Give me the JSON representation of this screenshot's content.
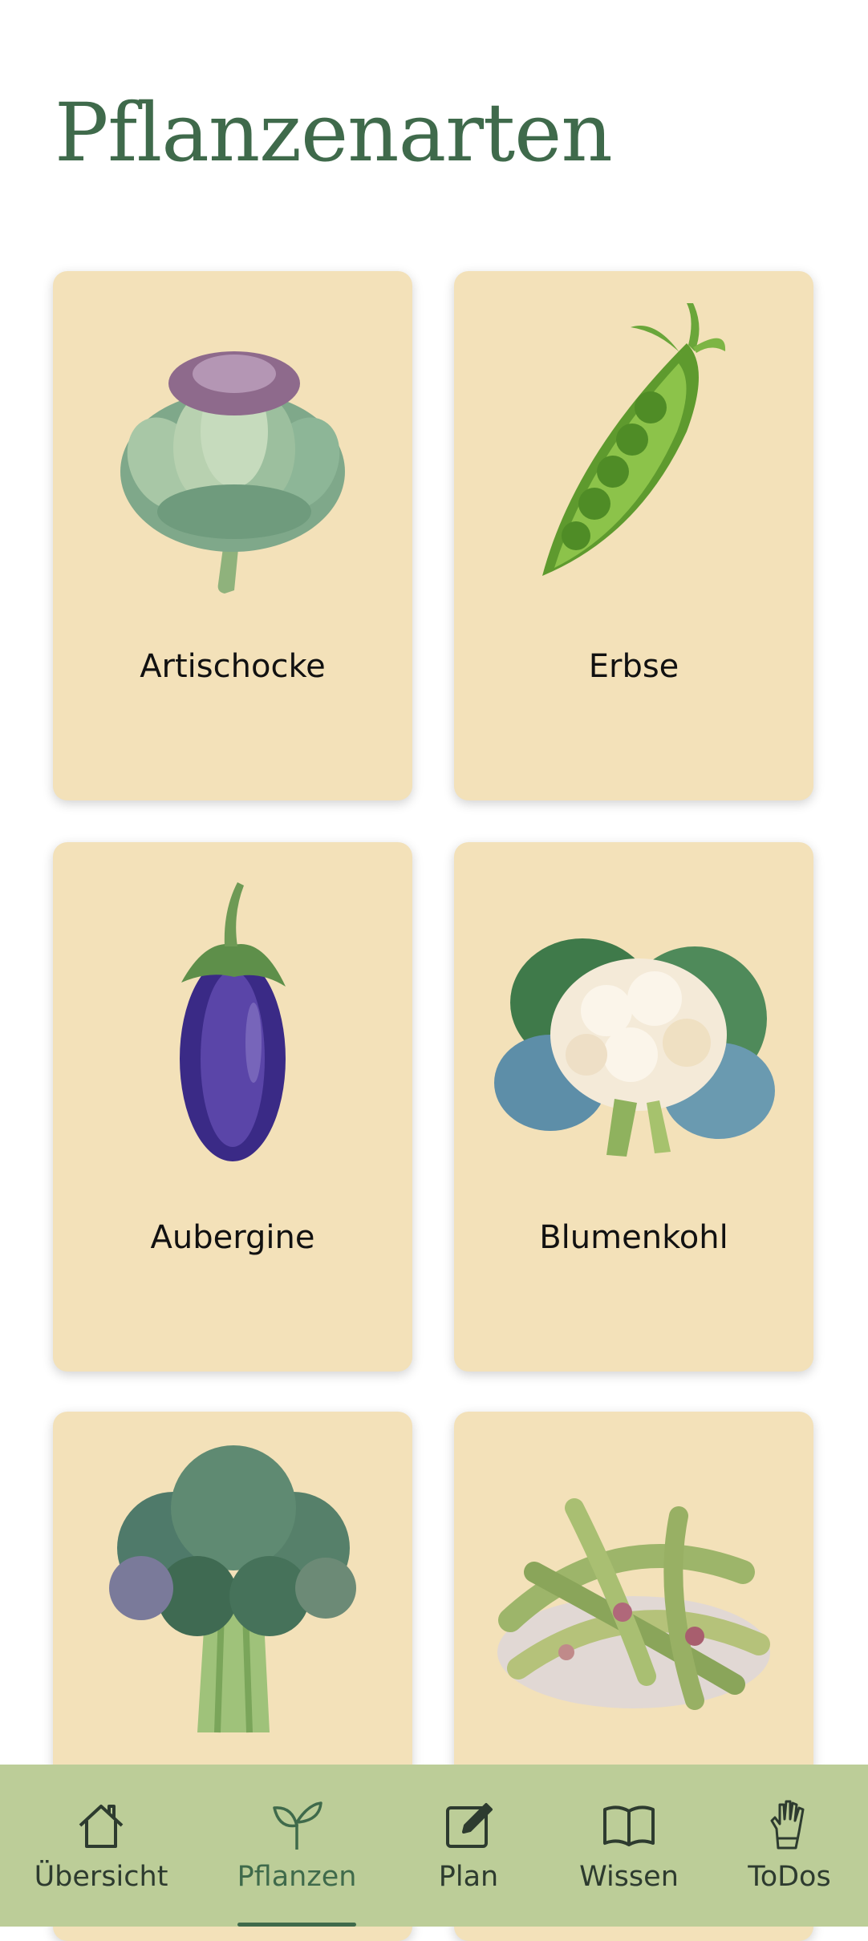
{
  "page": {
    "title": "Pflanzenarten"
  },
  "plants": [
    {
      "name": "Artischocke",
      "image": "artichoke-illustration"
    },
    {
      "name": "Erbse",
      "image": "pea-pod-illustration"
    },
    {
      "name": "Aubergine",
      "image": "eggplant-illustration"
    },
    {
      "name": "Blumenkohl",
      "image": "cauliflower-illustration"
    },
    {
      "name": "",
      "image": "broccoli-illustration"
    },
    {
      "name": "",
      "image": "beans-illustration"
    }
  ],
  "nav": {
    "items": [
      {
        "label": "Übersicht",
        "icon": "home-icon"
      },
      {
        "label": "Pflanzen",
        "icon": "sprout-icon",
        "active": true
      },
      {
        "label": "Plan",
        "icon": "edit-icon"
      },
      {
        "label": "Wissen",
        "icon": "book-icon"
      },
      {
        "label": "ToDos",
        "icon": "gloves-icon"
      }
    ]
  },
  "colors": {
    "title": "#3f6a4b",
    "card": "#f3e1b9",
    "nav_bg": "#bccd98",
    "nav_active": "#3f6a4b"
  }
}
